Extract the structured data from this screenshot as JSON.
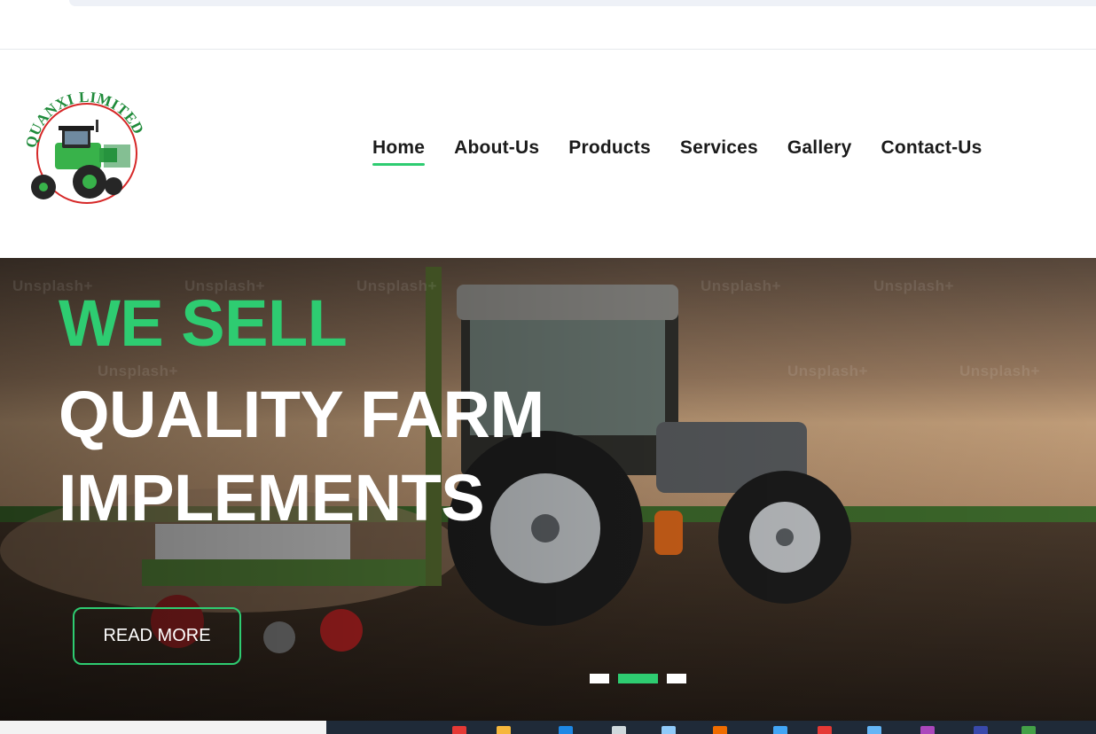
{
  "logo": {
    "text": "QUANXI LIMITED"
  },
  "nav": {
    "items": [
      {
        "label": "Home",
        "active": true
      },
      {
        "label": "About-Us",
        "active": false
      },
      {
        "label": "Products",
        "active": false
      },
      {
        "label": "Services",
        "active": false
      },
      {
        "label": "Gallery",
        "active": false
      },
      {
        "label": "Contact-Us",
        "active": false
      }
    ]
  },
  "hero": {
    "headline_green": "WE SELL",
    "headline_white_1": "QUALITY FARM",
    "headline_white_2": "IMPLEMENTS",
    "button_label": "READ MORE",
    "watermark": "Unsplash+",
    "slides": {
      "count": 3,
      "active_index": 1
    }
  },
  "colors": {
    "accent": "#2ecc71",
    "nav_text": "#1b1b1b",
    "taskbar": "#1f2a38"
  },
  "taskbar_icons": [
    "chrome-icon",
    "folder-icon",
    "edge-icon",
    "app-icon",
    "files-icon",
    "office-icon",
    "vscode-icon",
    "app-red-icon",
    "app-blue-icon",
    "app-purple-icon",
    "app-navy-icon",
    "excel-icon"
  ]
}
